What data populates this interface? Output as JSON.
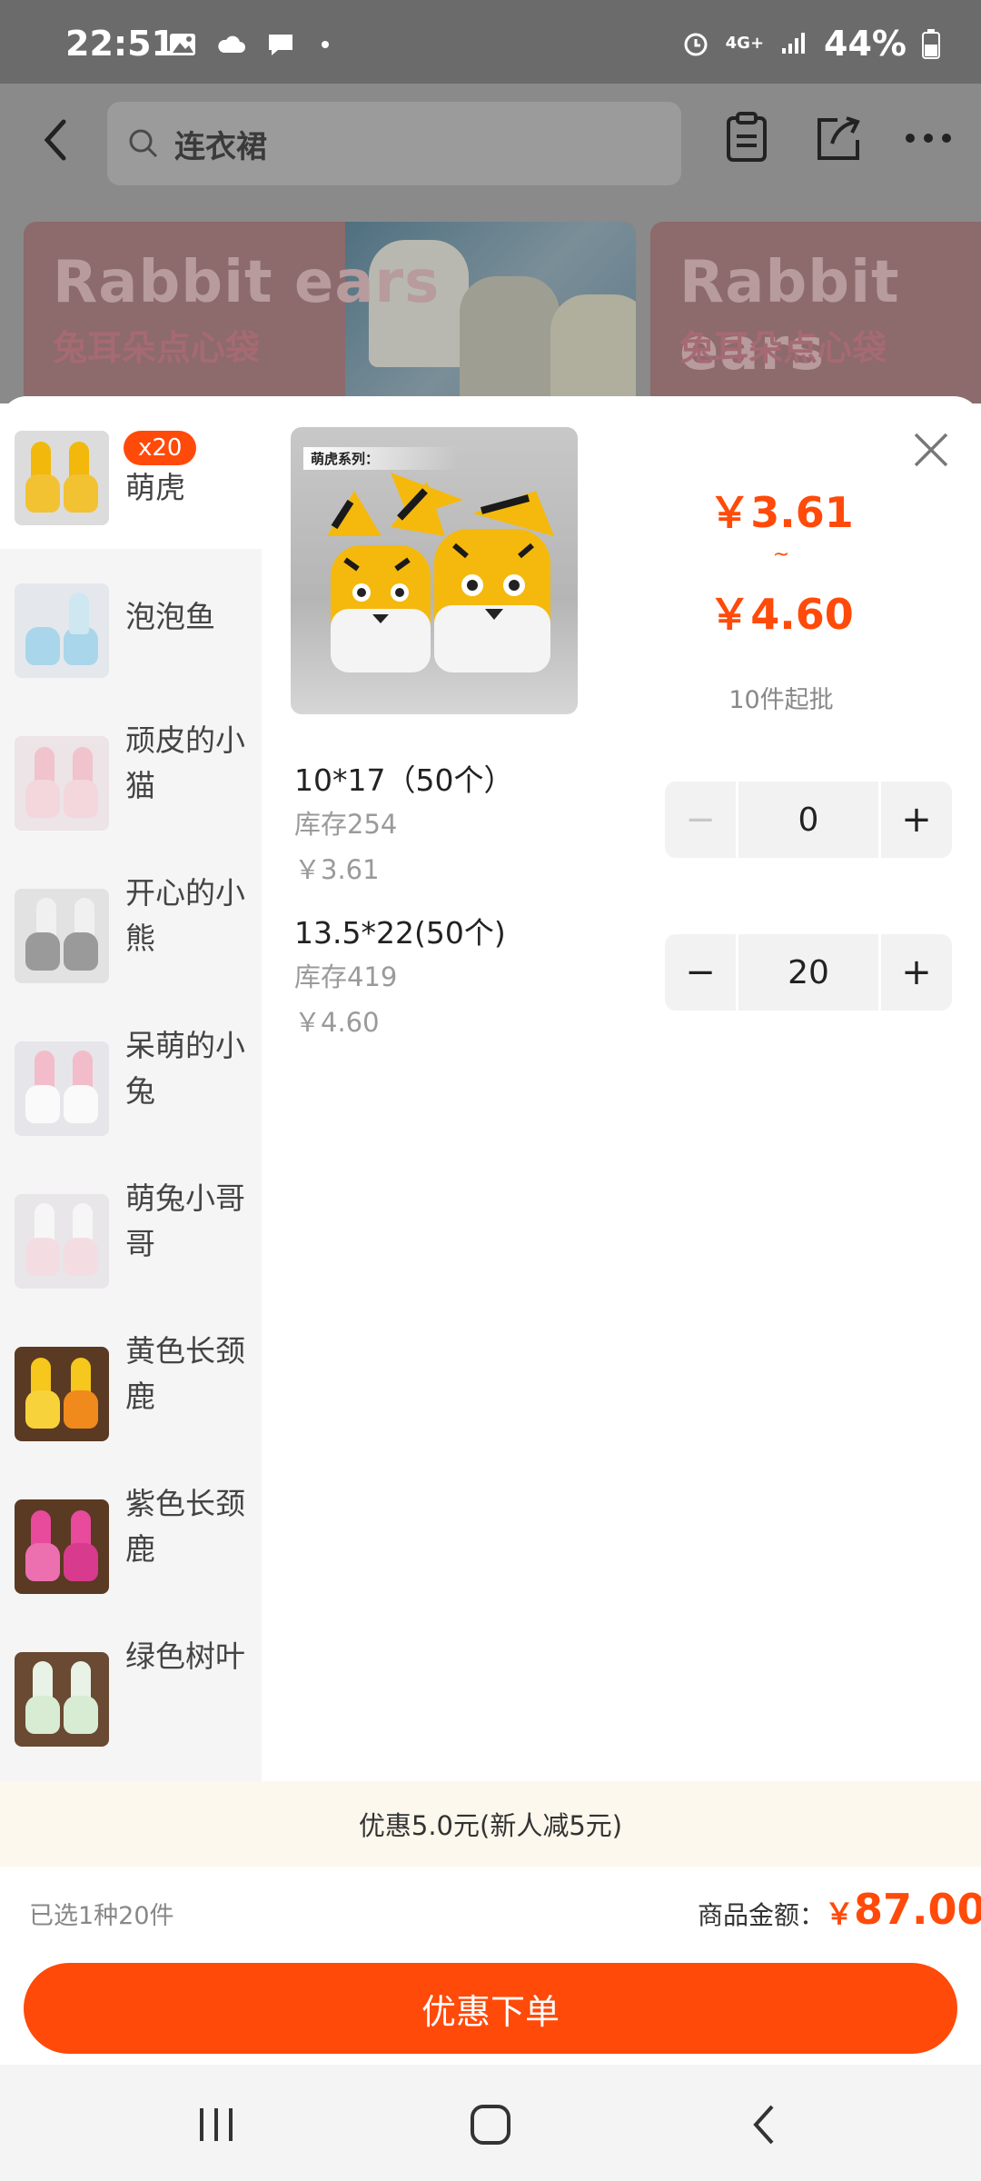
{
  "status_bar": {
    "time": "22:51",
    "network": "4G+",
    "battery": "44%"
  },
  "header": {
    "search_placeholder": "连衣裙"
  },
  "banners": [
    {
      "title_en": "Rabbit ears",
      "title_cn": "兔耳朵点心袋"
    },
    {
      "title_en": "Rabbit ears",
      "title_cn": "兔耳朵点心袋"
    }
  ],
  "sidebar": {
    "items": [
      {
        "label": "萌虎",
        "badge": "x20",
        "active": true
      },
      {
        "label": "泡泡鱼"
      },
      {
        "label": "顽皮的小猫"
      },
      {
        "label": "开心的小熊"
      },
      {
        "label": "呆萌的小兔"
      },
      {
        "label": "萌兔小哥哥"
      },
      {
        "label": "黄色长颈鹿"
      },
      {
        "label": "紫色长颈鹿"
      },
      {
        "label": "绿色树叶"
      }
    ]
  },
  "product": {
    "image_caption": "萌虎系列：",
    "price_low": "￥3.61",
    "tilde": "~",
    "price_high": "￥4.60",
    "min_order": "10件起批"
  },
  "skus": [
    {
      "title": "10*17（50个）",
      "stock": "库存254",
      "price": "￥3.61",
      "quantity": "0",
      "minus": "−",
      "plus": "+"
    },
    {
      "title": "13.5*22(50个)",
      "stock": "库存419",
      "price": "￥4.60",
      "quantity": "20",
      "minus": "−",
      "plus": "+"
    }
  ],
  "footer": {
    "discount_text": "优惠5.0元(新人减5元)",
    "selected_text": "已选1种20件",
    "amount_label": "商品金额：",
    "currency": "￥",
    "amount": "87.00",
    "order_button": "优惠下单"
  },
  "colors": {
    "accent": "#ff4a0a",
    "discount_bg": "#fdf8ed",
    "sidebar_bg": "#f5f5f5"
  }
}
